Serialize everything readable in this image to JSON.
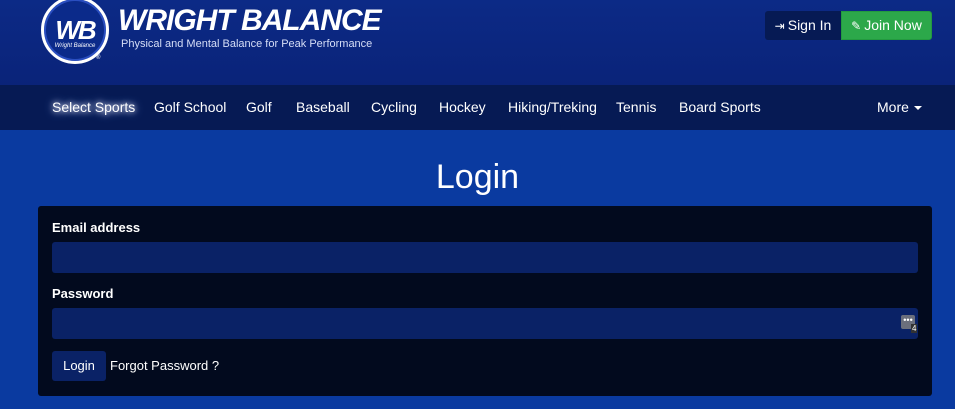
{
  "header": {
    "logo_text": "WB",
    "logo_small": "Wright Balance",
    "title": "WRIGHT BALANCE",
    "tagline": "Physical and Mental Balance for Peak Performance",
    "signin_label": "Sign In",
    "join_label": "Join Now",
    "signin_icon": "sign-in-icon",
    "join_icon": "edit-icon"
  },
  "nav": {
    "items": [
      {
        "label": "Select Sports"
      },
      {
        "label": "Golf School"
      },
      {
        "label": "Golf"
      },
      {
        "label": "Baseball"
      },
      {
        "label": "Cycling"
      },
      {
        "label": "Hockey"
      },
      {
        "label": "Hiking/Treking"
      },
      {
        "label": "Tennis"
      },
      {
        "label": "Board Sports"
      }
    ],
    "more_label": "More"
  },
  "main": {
    "title": "Login",
    "email_label": "Email address",
    "email_value": "",
    "password_label": "Password",
    "password_value": "",
    "password_manager_count": "4",
    "login_button": "Login",
    "forgot_link": "Forgot Password ?"
  },
  "colors": {
    "background": "#0a3aa0",
    "header": "#0c2a86",
    "nav": "#061a54",
    "panel": "#020a1e",
    "input": "#0a2266",
    "join_button": "#2ca84a"
  }
}
